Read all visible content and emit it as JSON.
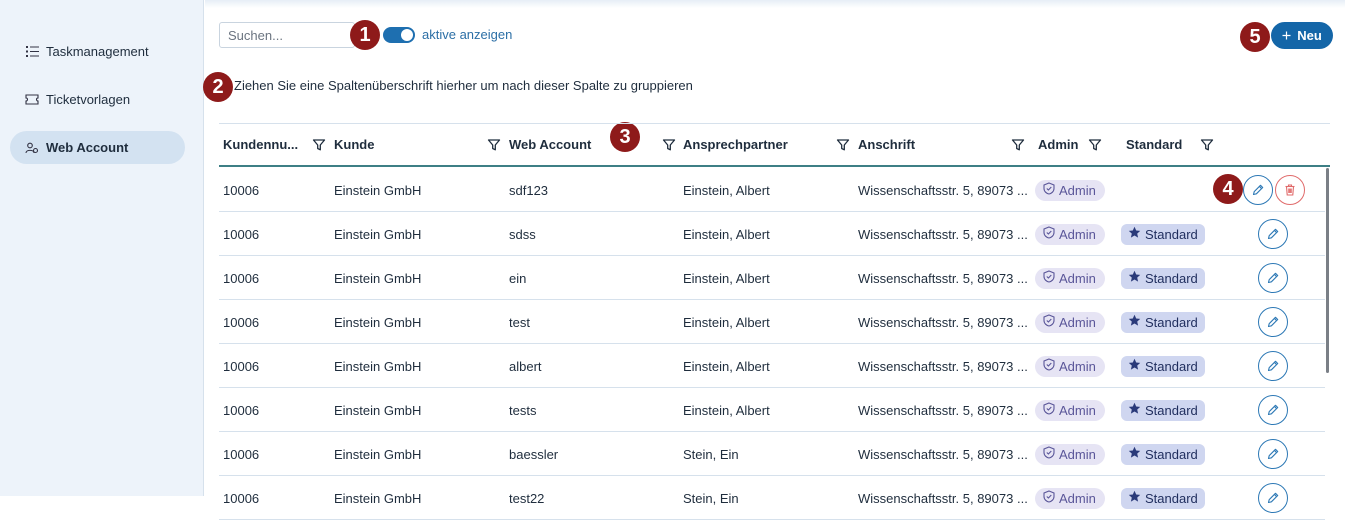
{
  "sidebar": {
    "items": [
      {
        "label": "Taskmanagement",
        "icon": "list-icon",
        "active": false
      },
      {
        "label": "Ticketvorlagen",
        "icon": "ticket-icon",
        "active": false
      },
      {
        "label": "Web Account",
        "icon": "users-icon",
        "active": true
      }
    ]
  },
  "toolbar": {
    "search_placeholder": "Suchen...",
    "search_value": "",
    "toggle_on": true,
    "toggle_label": "aktive anzeigen",
    "new_label": "Neu",
    "new_icon": "plus-icon"
  },
  "group_hint": "Ziehen Sie eine Spaltenüberschrift hierher um nach dieser Spalte zu gruppieren",
  "markers": [
    "1",
    "2",
    "3",
    "4",
    "5"
  ],
  "table": {
    "columns": [
      "Kundennu...",
      "Kunde",
      "Web Account",
      "Ansprechpartner",
      "Anschrift",
      "Admin",
      "Standard"
    ],
    "rows": [
      {
        "kundennr": "10006",
        "kunde": "Einstein GmbH",
        "account": "sdf123",
        "ansprechpartner": "Einstein, Albert",
        "anschrift": "Wissenschaftsstr. 5, 89073 ...",
        "admin": "Admin",
        "standard": "",
        "delete": true
      },
      {
        "kundennr": "10006",
        "kunde": "Einstein GmbH",
        "account": "sdss",
        "ansprechpartner": "Einstein, Albert",
        "anschrift": "Wissenschaftsstr. 5, 89073 ...",
        "admin": "Admin",
        "standard": "Standard",
        "delete": false
      },
      {
        "kundennr": "10006",
        "kunde": "Einstein GmbH",
        "account": "ein",
        "ansprechpartner": "Einstein, Albert",
        "anschrift": "Wissenschaftsstr. 5, 89073 ...",
        "admin": "Admin",
        "standard": "Standard",
        "delete": false
      },
      {
        "kundennr": "10006",
        "kunde": "Einstein GmbH",
        "account": "test",
        "ansprechpartner": "Einstein, Albert",
        "anschrift": "Wissenschaftsstr. 5, 89073 ...",
        "admin": "Admin",
        "standard": "Standard",
        "delete": false
      },
      {
        "kundennr": "10006",
        "kunde": "Einstein GmbH",
        "account": "albert",
        "ansprechpartner": "Einstein, Albert",
        "anschrift": "Wissenschaftsstr. 5, 89073 ...",
        "admin": "Admin",
        "standard": "Standard",
        "delete": false
      },
      {
        "kundennr": "10006",
        "kunde": "Einstein GmbH",
        "account": "tests",
        "ansprechpartner": "Einstein, Albert",
        "anschrift": "Wissenschaftsstr. 5, 89073 ...",
        "admin": "Admin",
        "standard": "Standard",
        "delete": false
      },
      {
        "kundennr": "10006",
        "kunde": "Einstein GmbH",
        "account": "baessler",
        "ansprechpartner": "Stein, Ein",
        "anschrift": "Wissenschaftsstr. 5, 89073 ...",
        "admin": "Admin",
        "standard": "Standard",
        "delete": false
      },
      {
        "kundennr": "10006",
        "kunde": "Einstein GmbH",
        "account": "test22",
        "ansprechpartner": "Stein, Ein",
        "anschrift": "Wissenschaftsstr. 5, 89073 ...",
        "admin": "Admin",
        "standard": "Standard",
        "delete": false
      }
    ]
  },
  "colors": {
    "accent": "#1466a8",
    "marker": "#8e1a1a",
    "sidebar_bg": "#edf3fa",
    "header_line": "#3d7f85",
    "delete": "#e06a6a"
  }
}
